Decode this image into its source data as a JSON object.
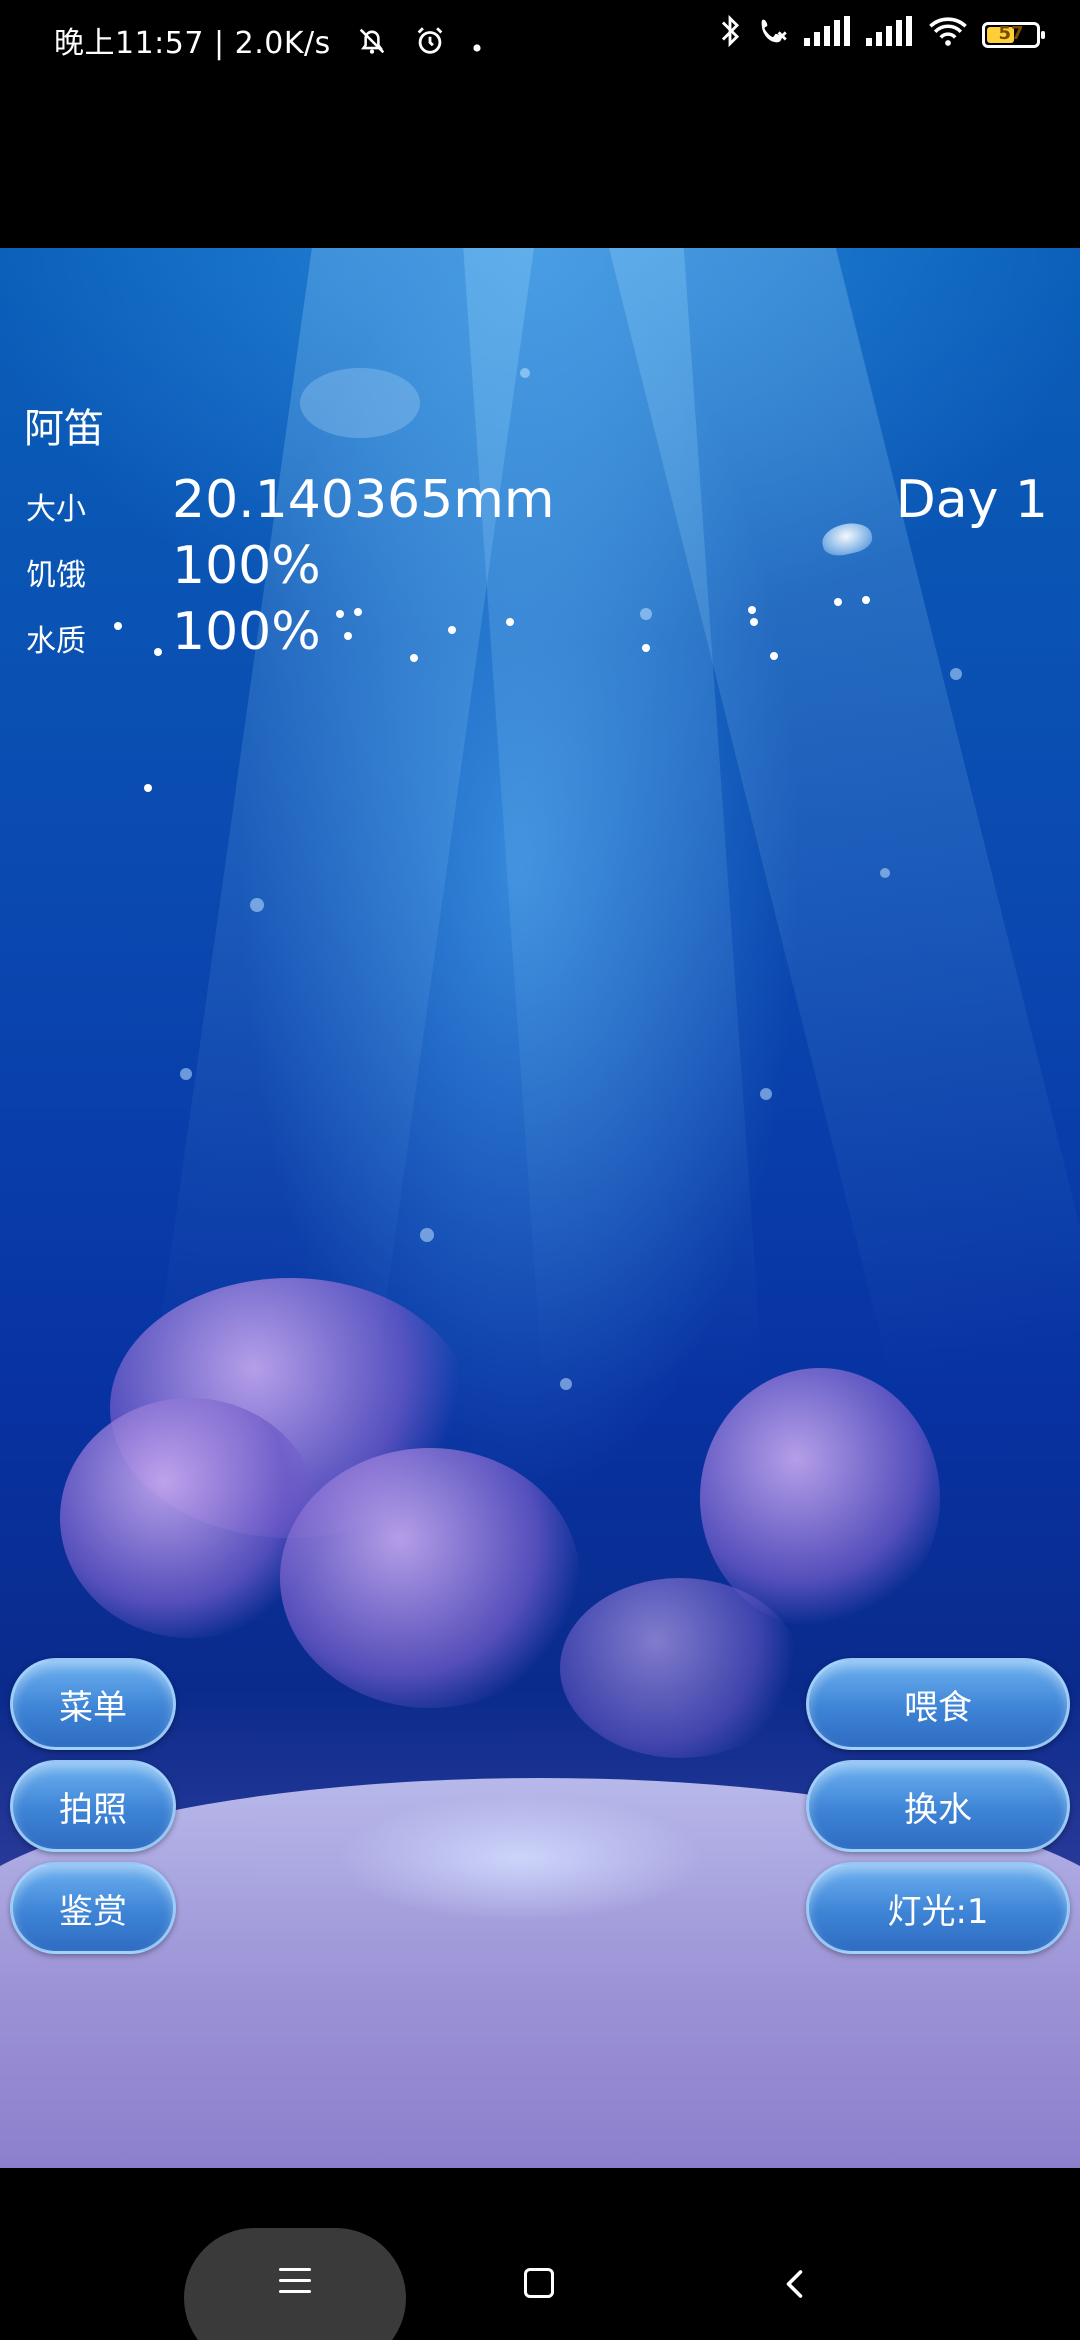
{
  "status_bar": {
    "time": "晚上11:57",
    "separator": "|",
    "net_speed": "2.0K/s",
    "battery_text": "57",
    "battery_level": 0.57,
    "icons": [
      "mute-bell-icon",
      "alarm-icon",
      "dot-icon",
      "bluetooth-icon",
      "call-forward-icon",
      "signal-icon",
      "signal-icon",
      "wifi-icon",
      "battery-icon"
    ]
  },
  "hud": {
    "pet_name": "阿笛",
    "stats": [
      {
        "label": "大小",
        "value": "20.140365mm"
      },
      {
        "label": "饥饿",
        "value": "100%"
      },
      {
        "label": "水质",
        "value": "100%"
      }
    ],
    "day": "Day 1"
  },
  "buttons_left": [
    {
      "label": "菜单"
    },
    {
      "label": "拍照"
    },
    {
      "label": "鉴赏"
    }
  ],
  "buttons_right": [
    {
      "label": "喂食"
    },
    {
      "label": "换水"
    },
    {
      "label": "灯光:1"
    }
  ],
  "nav": {
    "icons": [
      "menu-icon",
      "home-icon",
      "back-icon"
    ]
  },
  "colors": {
    "background": "#000000",
    "water_top": "#0a5fb8",
    "water_bottom": "#6b63b7",
    "button": "#3e84d6"
  }
}
